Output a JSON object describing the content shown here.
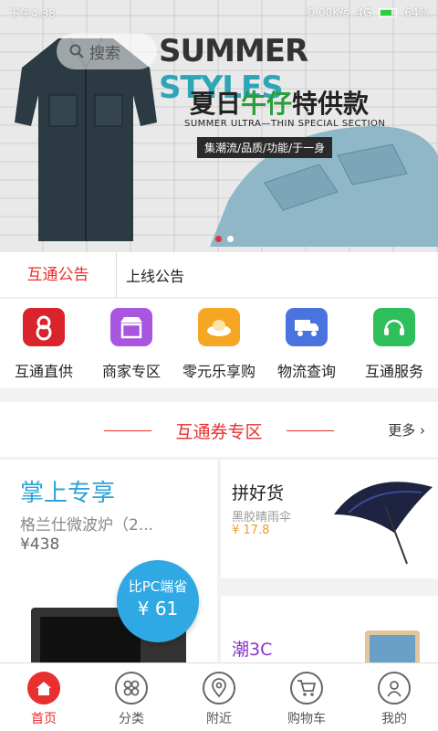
{
  "status_bar": {
    "time": "下午4:38",
    "net_speed": "0.00K/s",
    "signal": "4G",
    "battery": "64%"
  },
  "search": {
    "placeholder": "搜索"
  },
  "banner": {
    "title_en_1": "SUMMER",
    "title_en_2": "STYLES",
    "title_cn_1": "夏日",
    "title_cn_hl": "牛仔",
    "title_cn_2": "特供款",
    "subtitle": "SUMMER ULTRA—THIN SPECIAL SECTION",
    "tagline": "集潮流/品质/功能/于一身",
    "slide_count": 2,
    "active_slide": 1
  },
  "notice": {
    "label": "互通公告",
    "text": "上线公告"
  },
  "shortcuts": [
    {
      "label": "互通直供",
      "icon": "hutong-logo-icon",
      "color": "#d9232d"
    },
    {
      "label": "商家专区",
      "icon": "shop-icon",
      "color": "#a855e0"
    },
    {
      "label": "零元乐享购",
      "icon": "gold-ingot-icon",
      "color": "#f5a623"
    },
    {
      "label": "物流查询",
      "icon": "truck-icon",
      "color": "#4a73e0"
    },
    {
      "label": "互通服务",
      "icon": "headset-icon",
      "color": "#2ebf5a"
    }
  ],
  "section": {
    "title": "互通券专区",
    "more": "更多"
  },
  "cards": {
    "left": {
      "title": "掌上专享",
      "subtitle": "格兰仕微波炉（2...",
      "price": "¥438",
      "badge_line1": "比PC端省",
      "badge_line2": "¥ 61"
    },
    "right_top": {
      "title": "拼好货",
      "subtitle": "黑胶晴雨伞",
      "price": "¥ 17.8"
    },
    "right_bottom": {
      "title": "潮3C"
    }
  },
  "tabbar": [
    {
      "label": "首页",
      "icon": "home-icon",
      "active": true
    },
    {
      "label": "分类",
      "icon": "category-icon",
      "active": false
    },
    {
      "label": "附近",
      "icon": "location-icon",
      "active": false
    },
    {
      "label": "购物车",
      "icon": "cart-icon",
      "active": false
    },
    {
      "label": "我的",
      "icon": "user-icon",
      "active": false
    }
  ],
  "colors": {
    "accent": "#e8302f",
    "blue": "#2fa3d8",
    "purple": "#8b32c8",
    "orange": "#f29a2e"
  }
}
